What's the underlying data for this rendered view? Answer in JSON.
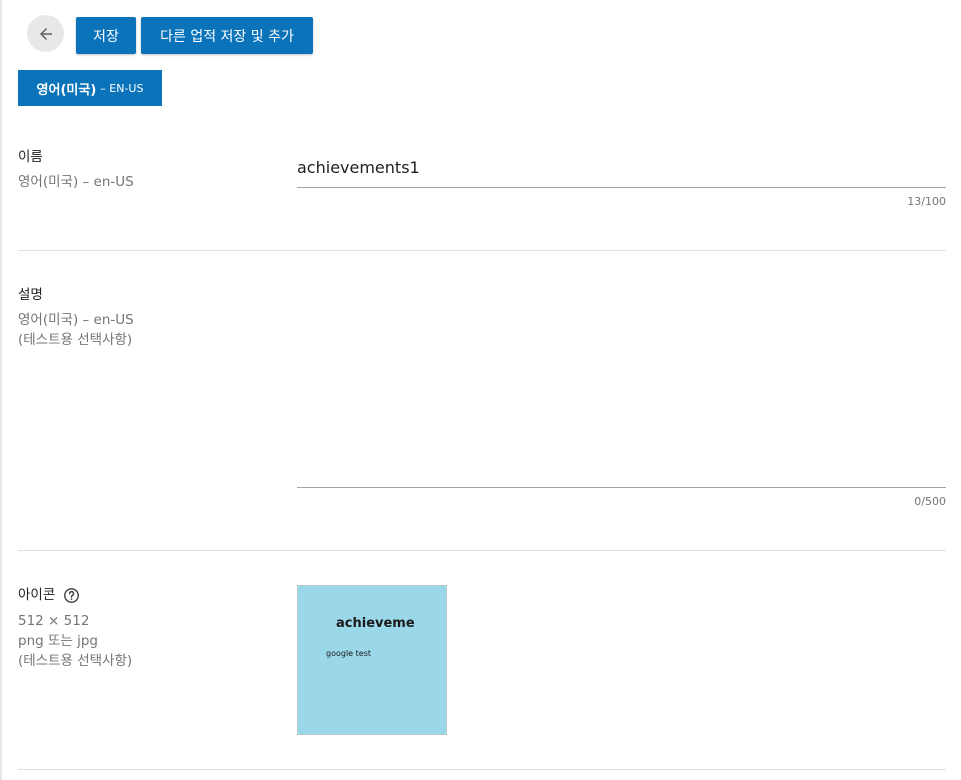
{
  "toolbar": {
    "save_label": "저장",
    "save_add_label": "다른 업적 저장 및 추가"
  },
  "language_tab": {
    "name": "영어(미국)",
    "code": "– EN-US"
  },
  "name_section": {
    "title": "이름",
    "language": "영어(미국) – en-US",
    "value": "achievements1",
    "counter": "13/100"
  },
  "description_section": {
    "title": "설명",
    "language": "영어(미국) – en-US",
    "note": "(테스트용 선택사항)",
    "value": "",
    "counter": "0/500"
  },
  "icon_section": {
    "title": "아이콘",
    "size": "512 × 512",
    "format": "png 또는 jpg",
    "note": "(테스트용 선택사항)",
    "preview_title": "achieveme",
    "preview_subtitle": "google test",
    "preview_color": "#9ad7e9"
  },
  "colors": {
    "accent": "#0b73ba"
  }
}
